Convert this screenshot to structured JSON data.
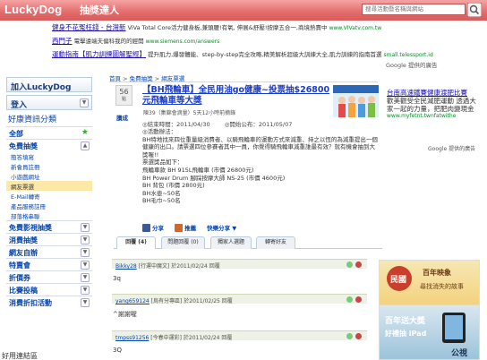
{
  "header": {
    "logo": "LuckyDog",
    "logo_sub": "抽獎達人",
    "search_placeholder": "搜尋活動暨名稱與網站"
  },
  "ads_top": [
    {
      "title": "健身不花冤枉錢 - 台灣新",
      "desc": "ViVa Total Core活力健身板,兼頭腰!有氧, 伸展&舒壓!按摩五合一,商境熱賣中",
      "url": "www.VIVatv.com.tw"
    },
    {
      "title": "西門子",
      "desc": "電擊遠端夫偏科我的的經開",
      "url": "www.siemens.com/answers"
    },
    {
      "title": "運動指南【肌力訓練圖解聖經】",
      "desc": "提升肌力,爆發體能、step-by-step完全攻略,精美解析超級大訓練大全,肌力訓練的指南首選",
      "url": "small.telessport.id"
    }
  ],
  "google_ads_label": "Google 提供的廣告",
  "sidebar": {
    "join": "加入LuckyDog",
    "login": "登入",
    "section": "好康資訊分類",
    "all": "全部",
    "categories": [
      {
        "label": "免費抽獎",
        "subs": [
          "簡答填寫",
          "新會員註冊",
          "小遊戲網址",
          "網友票選",
          "E-Mail轉寄",
          "產品服務註冊",
          "部落格串聯"
        ]
      },
      {
        "label": "免費影視抽獎"
      },
      {
        "label": "消費抽獎"
      },
      {
        "label": "網友自辦"
      },
      {
        "label": "特賣會"
      },
      {
        "label": "折價券"
      },
      {
        "label": "比賽投稿"
      },
      {
        "label": "消費折扣活動"
      }
    ],
    "active_sub": "網友票選",
    "footer": "好用連結區"
  },
  "breadcrumb": [
    "首頁",
    "免費抽獎",
    "網友票選"
  ],
  "post": {
    "score": "56",
    "score_unit": "點",
    "vote": "讚成",
    "title": "【BH飛輪車】全民用油go健康~投票抽$26800元飛輪車等大獎",
    "author": "陳39（集錦會滴量）5天12小時前摘錄",
    "end_label": "◎結束時間：2011/04/30",
    "announce_label": "◎開始公布：2011/05/07",
    "paragraphs": [
      "◎活動辦法：",
      "BH特地找來四位重量級消費者、以騎飛輪車的運動方式來減重、持之以恆的為減重提出一個健康的出口。請票選四位參賽者其中一員，你覺得騎飛輪車減重誰最有效？就有機會抽到大獎喔!!",
      "票選獎品如下：",
      "飛輪車款 BH 915L飛輪車 (市價 26800元)",
      "BH Power Drum 腳踩按摩大師 NS-25 (市價 4600元)",
      "BH 背包 (市價 2800元)",
      "BH水壺~50名",
      "BH毛巾~50名"
    ],
    "share": [
      "分享",
      "推薦",
      "快樂分享"
    ]
  },
  "tabs": [
    "回覆 (4)",
    "問題回覆 (0)",
    "獨家人選題",
    "轉寄好友"
  ],
  "comments": [
    {
      "user": "Bikky28",
      "status": "[行運中魔文]",
      "date": "於2011/02/24",
      "action": "回覆",
      "text": "3q"
    },
    {
      "user": "yang659124",
      "status": "[烏有分專區]",
      "date": "於2011/02/25",
      "action": "回覆",
      "text": "^謝謝喔"
    },
    {
      "user": "tmpss91256",
      "status": "[今春中運彩]",
      "date": "於2011/02/24",
      "action": "回覆",
      "text": "3Q"
    }
  ],
  "right_ad": {
    "title": "台南高速鐵賽健康渡肥比賽",
    "desc": "歡美觀受全民減肥運動 透過大家一起的力量，把肥肉變現金",
    "url": "www.myfetnt.twnfatwithe"
  },
  "right_google": "Google 提供的廣告",
  "promo": {
    "brand": "民國",
    "tag": "百年映象",
    "line1": "尋找消失的故事",
    "line2": "百年送大獎",
    "line3": "好禮抽 iPad",
    "corner": "公視"
  }
}
